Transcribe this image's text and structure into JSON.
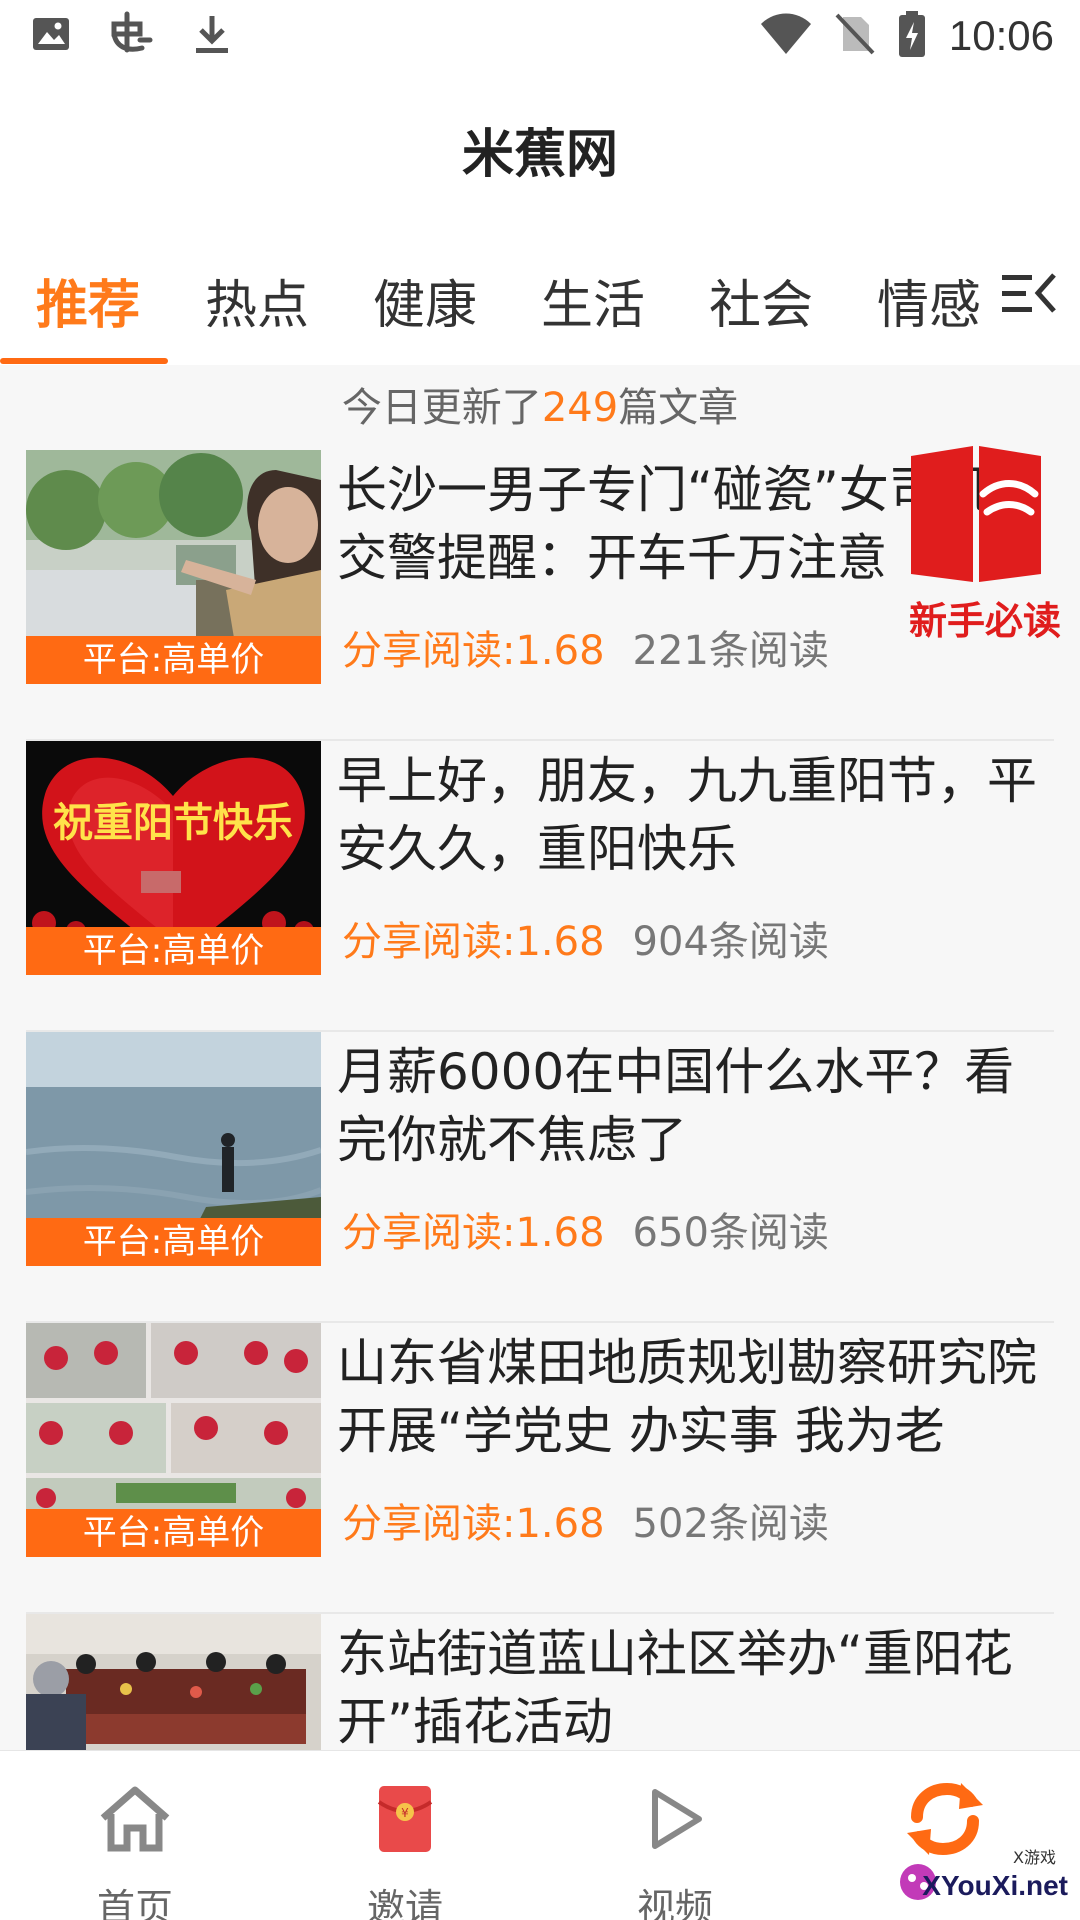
{
  "status_bar": {
    "time": "10:06",
    "left_icons": [
      "image-icon",
      "app-notification-icon",
      "download-icon"
    ],
    "right_icons": [
      "wifi-icon",
      "no-sim-icon",
      "battery-charging-icon"
    ]
  },
  "app": {
    "title": "米蕉网"
  },
  "tabs": [
    {
      "label": "推荐",
      "active": true
    },
    {
      "label": "热点",
      "active": false
    },
    {
      "label": "健康",
      "active": false
    },
    {
      "label": "生活",
      "active": false
    },
    {
      "label": "社会",
      "active": false
    },
    {
      "label": "情感",
      "active": false
    }
  ],
  "feed": {
    "update_prefix": "今日更新了",
    "update_count": "249",
    "update_suffix": "篇文章",
    "articles": [
      {
        "title": "长沙一男子专门“碰瓷”女司机？交警提醒：开车千万注意",
        "tag": "平台:高单价",
        "share": "分享阅读:1.68",
        "reads": "221条阅读"
      },
      {
        "title": "早上好，朋友，九九重阳节，平安久久，重阳快乐",
        "tag": "平台:高单价",
        "share": "分享阅读:1.68",
        "reads": "904条阅读",
        "image_text": "祝重阳节快乐"
      },
      {
        "title": "月薪6000在中国什么水平？看完你就不焦虑了",
        "tag": "平台:高单价",
        "share": "分享阅读:1.68",
        "reads": "650条阅读"
      },
      {
        "title": "山东省煤田地质规划勘察研究院开展“学党史 办实事 我为老",
        "tag": "平台:高单价",
        "share": "分享阅读:1.68",
        "reads": "502条阅读"
      },
      {
        "title": "东站街道蓝山社区举办“重阳花开”插花活动",
        "tag": "",
        "share": "",
        "reads": ""
      }
    ]
  },
  "float_banner": {
    "label": "新手必读"
  },
  "bottom_nav": [
    {
      "label": "首页",
      "icon": "home-icon"
    },
    {
      "label": "邀请",
      "icon": "red-envelope-icon"
    },
    {
      "label": "视频",
      "icon": "play-icon"
    },
    {
      "label": "",
      "icon": "refresh-icon"
    }
  ],
  "watermark": {
    "text": "XYouXi.net",
    "small": "X游戏"
  },
  "colors": {
    "accent": "#ff7a1a",
    "tag_bg": "#ff6a13",
    "banner_red": "#e01d1d"
  }
}
